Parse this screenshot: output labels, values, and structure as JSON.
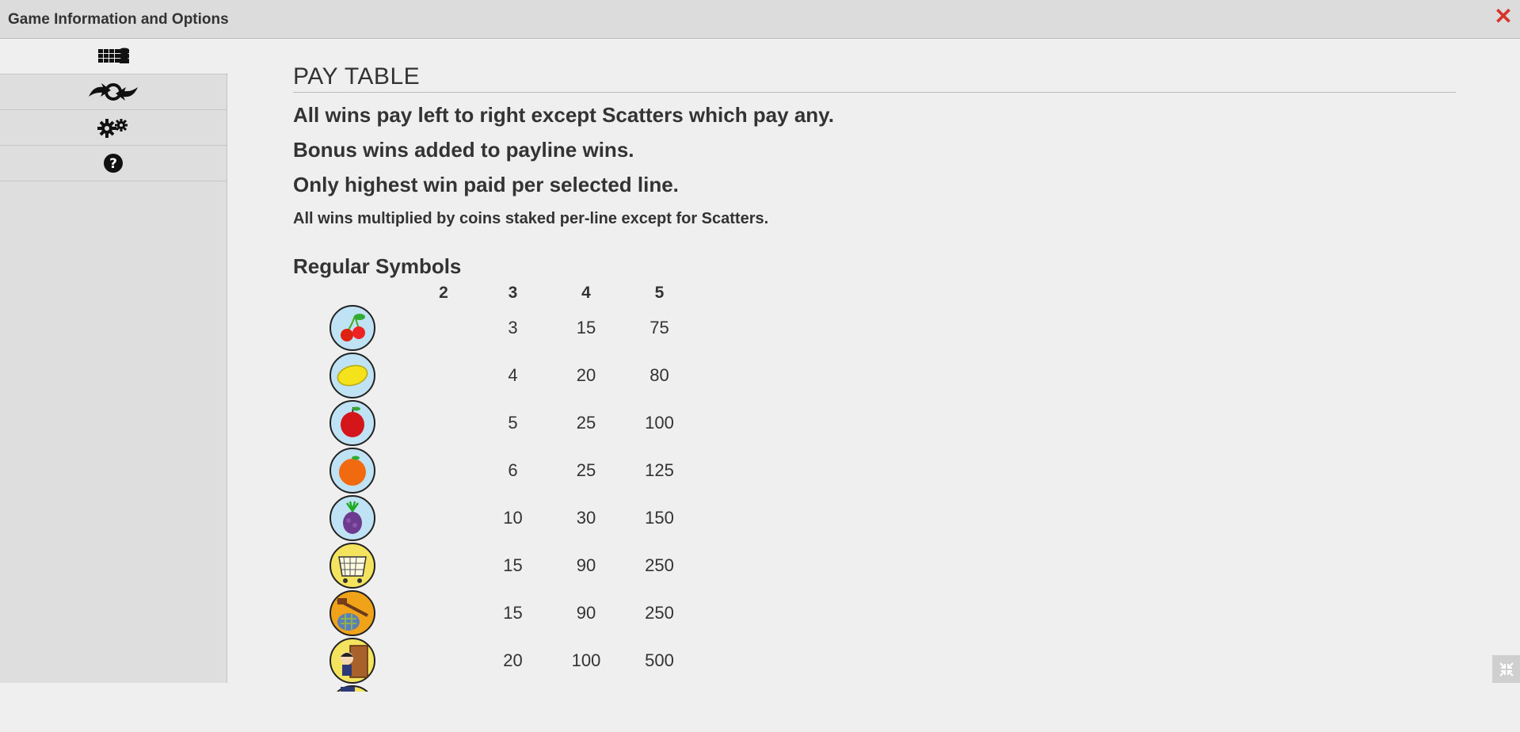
{
  "window": {
    "title": "Game Information and Options"
  },
  "sidebar": {
    "tabs": [
      {
        "icon": "paytable-icon",
        "active": true
      },
      {
        "icon": "autoplay-icon",
        "active": false
      },
      {
        "icon": "settings-icon",
        "active": false
      },
      {
        "icon": "help-icon",
        "active": false
      }
    ]
  },
  "paytable": {
    "heading": "PAY TABLE",
    "rules": [
      "All wins pay left to right except Scatters which pay any.",
      "Bonus wins added to payline wins.",
      "Only highest win paid per selected line."
    ],
    "note": "All wins multiplied by coins staked per-line except for Scatters.",
    "section_title": "Regular Symbols",
    "columns": [
      "2",
      "3",
      "4",
      "5"
    ],
    "rows": [
      {
        "symbol": "cherry-icon",
        "pays": [
          "",
          "3",
          "15",
          "75"
        ]
      },
      {
        "symbol": "lemon-icon",
        "pays": [
          "",
          "4",
          "20",
          "80"
        ]
      },
      {
        "symbol": "apple-icon",
        "pays": [
          "",
          "5",
          "25",
          "100"
        ]
      },
      {
        "symbol": "orange-icon",
        "pays": [
          "",
          "6",
          "25",
          "125"
        ]
      },
      {
        "symbol": "grapes-icon",
        "pays": [
          "",
          "10",
          "30",
          "150"
        ]
      },
      {
        "symbol": "basket-icon",
        "pays": [
          "",
          "15",
          "90",
          "250"
        ]
      },
      {
        "symbol": "bindle-icon",
        "pays": [
          "",
          "15",
          "90",
          "250"
        ]
      },
      {
        "symbol": "character-icon",
        "pays": [
          "",
          "20",
          "100",
          "500"
        ]
      }
    ]
  },
  "colors": {
    "close": "#d9342b",
    "background": "#efefef",
    "titlebar": "#dcdcdc"
  }
}
